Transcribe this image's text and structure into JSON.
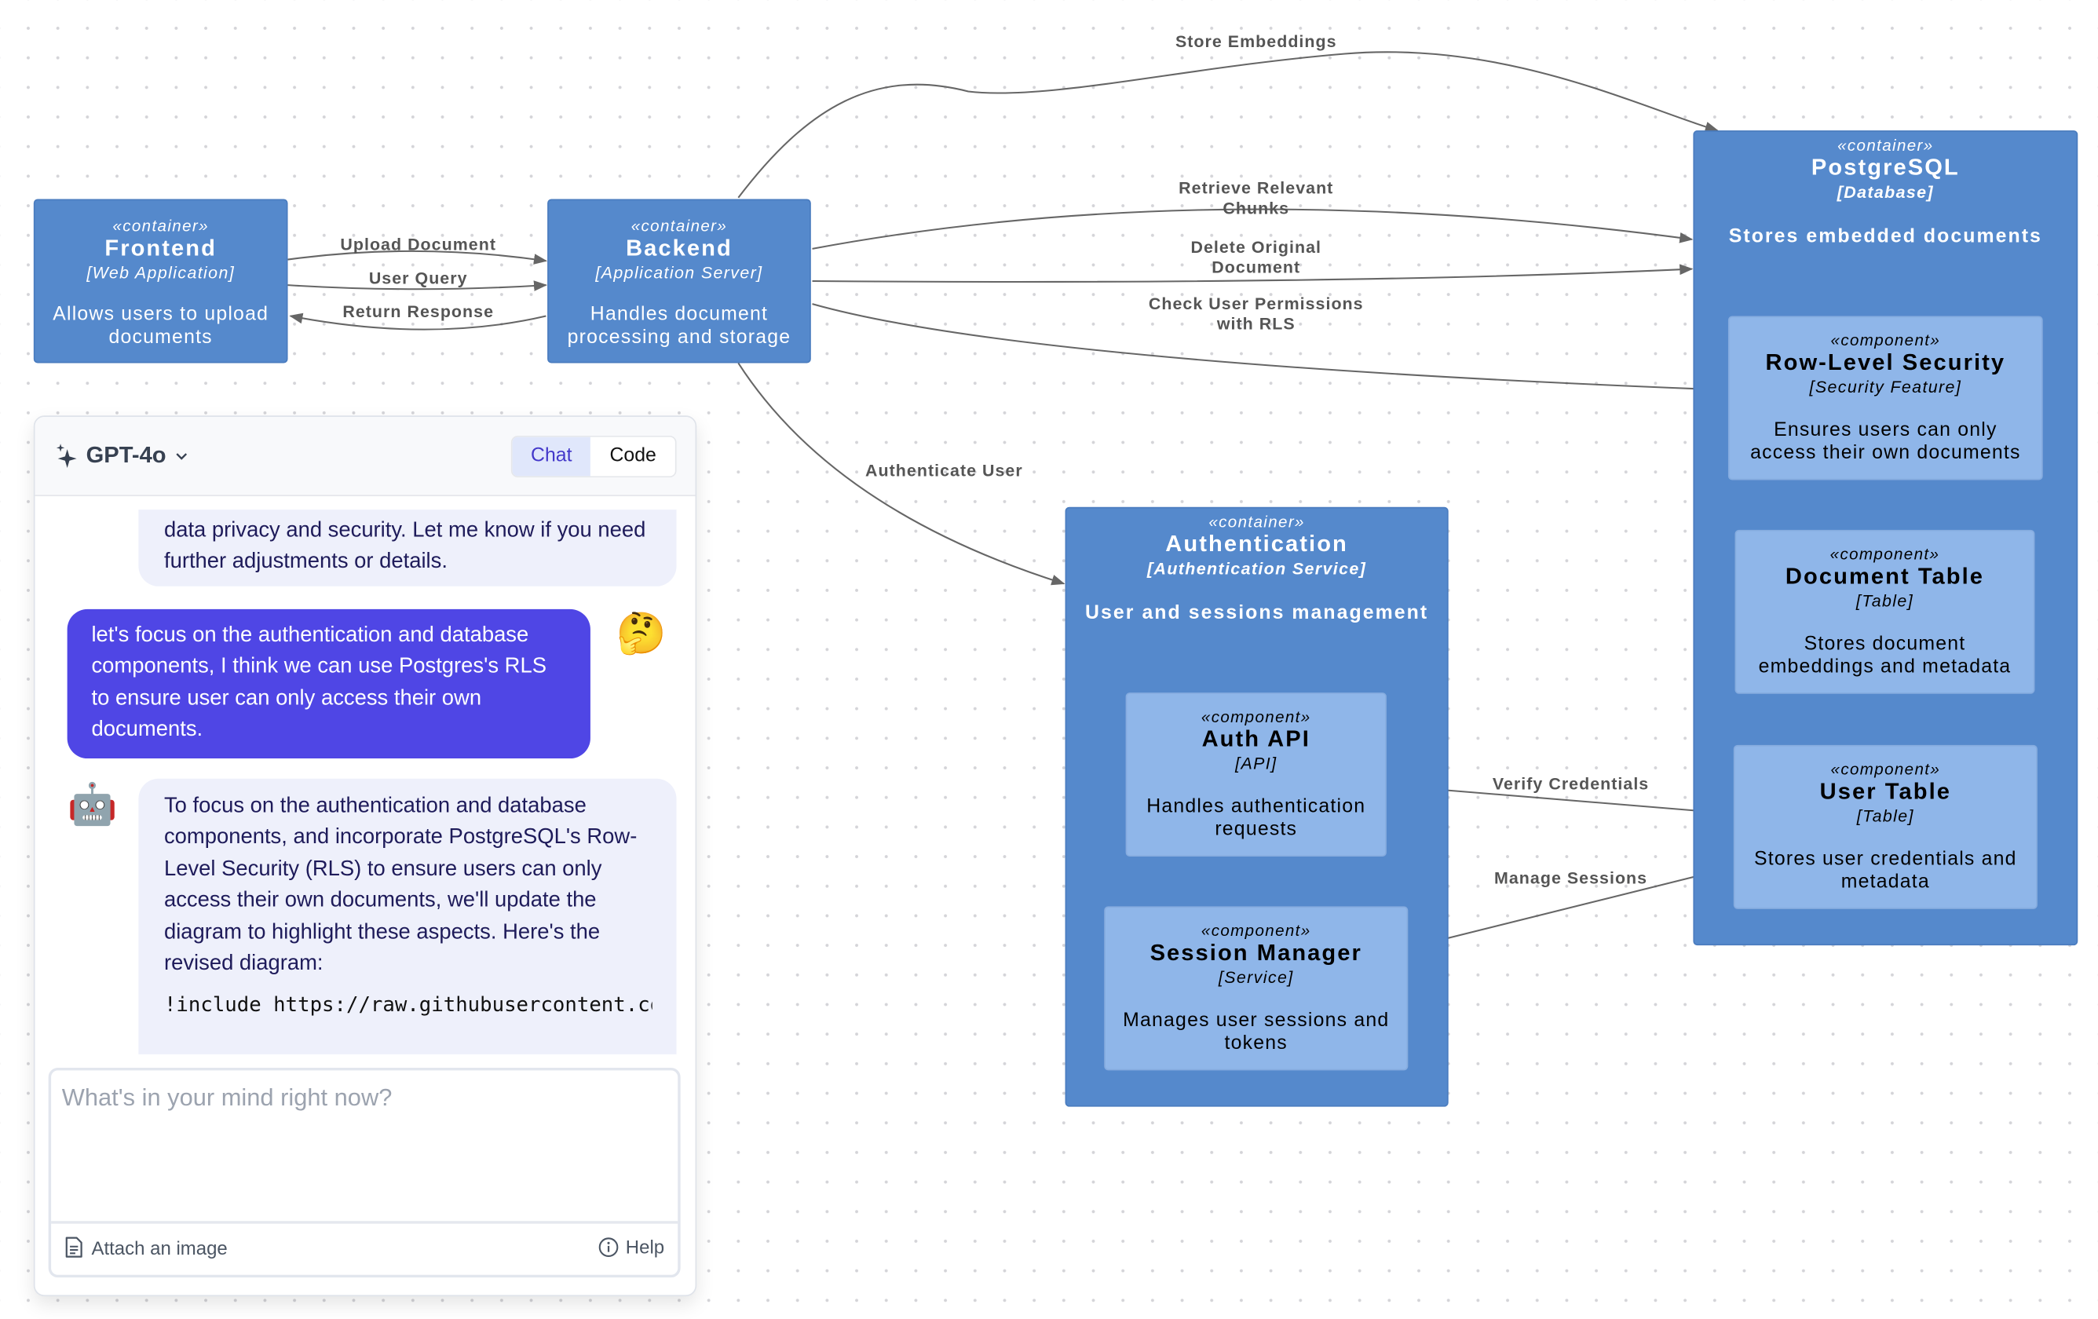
{
  "diagram": {
    "containers": [
      {
        "id": "frontend",
        "stereotype": "«container»",
        "title": "Frontend",
        "tech": "[Web Application]",
        "desc": "Allows users to upload documents"
      },
      {
        "id": "backend",
        "stereotype": "«container»",
        "title": "Backend",
        "tech": "[Application Server]",
        "desc": "Handles document processing and storage"
      },
      {
        "id": "postgres",
        "stereotype": "«container»",
        "title": "PostgreSQL",
        "tech": "[Database]",
        "desc": "Stores embedded documents"
      },
      {
        "id": "auth",
        "stereotype": "«container»",
        "title": "Authentication",
        "tech": "[Authentication Service]",
        "desc": "User and sessions management"
      }
    ],
    "components": [
      {
        "id": "rls",
        "stereotype": "«component»",
        "title": "Row-Level Security",
        "tech": "[Security Feature]",
        "desc": "Ensures users can only access their own documents"
      },
      {
        "id": "doctable",
        "stereotype": "«component»",
        "title": "Document Table",
        "tech": "[Table]",
        "desc": "Stores document embeddings and metadata"
      },
      {
        "id": "usertable",
        "stereotype": "«component»",
        "title": "User Table",
        "tech": "[Table]",
        "desc": "Stores user credentials and metadata"
      },
      {
        "id": "authapi",
        "stereotype": "«component»",
        "title": "Auth API",
        "tech": "[API]",
        "desc": "Handles authentication requests"
      },
      {
        "id": "session",
        "stereotype": "«component»",
        "title": "Session Manager",
        "tech": "[Service]",
        "desc": "Manages user sessions and tokens"
      }
    ],
    "edges": [
      {
        "from": "frontend",
        "to": "backend",
        "label": "Upload Document"
      },
      {
        "from": "frontend",
        "to": "backend",
        "label": "User Query"
      },
      {
        "from": "backend",
        "to": "frontend",
        "label": "Return Response"
      },
      {
        "from": "backend",
        "to": "postgres",
        "label": "Store Embeddings"
      },
      {
        "from": "backend",
        "to": "postgres",
        "label": "Retrieve Relevant Chunks"
      },
      {
        "from": "backend",
        "to": "postgres",
        "label": "Delete Original Document"
      },
      {
        "from": "backend",
        "to": "rls",
        "label": "Check User Permissions with RLS"
      },
      {
        "from": "backend",
        "to": "auth",
        "label": "Authenticate User"
      },
      {
        "from": "authapi",
        "to": "usertable",
        "label": "Verify Credentials"
      },
      {
        "from": "session",
        "to": "usertable",
        "label": "Manage Sessions"
      }
    ],
    "colors": {
      "container": "#5589cc",
      "component": "#8fb6e9",
      "edge": "#666666"
    }
  },
  "chat": {
    "model": "GPT-4o",
    "tabs": [
      {
        "label": "Chat",
        "active": true
      },
      {
        "label": "Code",
        "active": false
      }
    ],
    "messages": [
      {
        "role": "assistant",
        "text": "data privacy and security. Let me know if you need further adjustments or details."
      },
      {
        "role": "user",
        "text": "let's focus on the authentication and database components, I think we can use Postgres's RLS to ensure user can only access their own documents.",
        "avatar": "🤔"
      },
      {
        "role": "assistant",
        "text": "To focus on the authentication and database components, and incorporate PostgreSQL's Row-Level Security (RLS) to ensure users can only access their own documents, we'll update the diagram to highlight these aspects. Here's the revised diagram:",
        "code": "!include https://raw.githubusercontent.com",
        "avatar": "🤖"
      }
    ],
    "input": {
      "value": "",
      "placeholder": "What's in your mind right now?"
    },
    "attach_label": "Attach an image",
    "help_label": "Help"
  }
}
